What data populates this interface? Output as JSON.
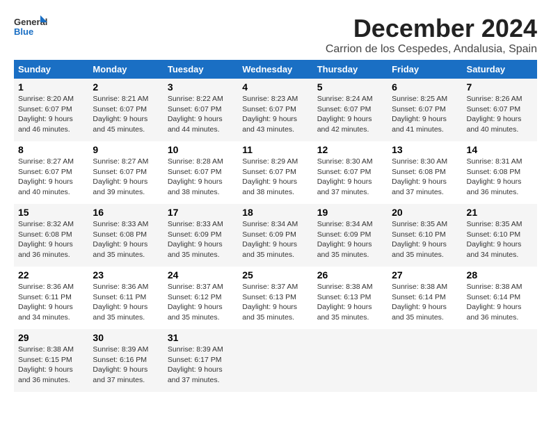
{
  "logo": {
    "line1": "General",
    "line2": "Blue"
  },
  "title": "December 2024",
  "subtitle": "Carrion de los Cespedes, Andalusia, Spain",
  "days_header": [
    "Sunday",
    "Monday",
    "Tuesday",
    "Wednesday",
    "Thursday",
    "Friday",
    "Saturday"
  ],
  "weeks": [
    [
      {
        "day": "1",
        "info": "Sunrise: 8:20 AM\nSunset: 6:07 PM\nDaylight: 9 hours\nand 46 minutes."
      },
      {
        "day": "2",
        "info": "Sunrise: 8:21 AM\nSunset: 6:07 PM\nDaylight: 9 hours\nand 45 minutes."
      },
      {
        "day": "3",
        "info": "Sunrise: 8:22 AM\nSunset: 6:07 PM\nDaylight: 9 hours\nand 44 minutes."
      },
      {
        "day": "4",
        "info": "Sunrise: 8:23 AM\nSunset: 6:07 PM\nDaylight: 9 hours\nand 43 minutes."
      },
      {
        "day": "5",
        "info": "Sunrise: 8:24 AM\nSunset: 6:07 PM\nDaylight: 9 hours\nand 42 minutes."
      },
      {
        "day": "6",
        "info": "Sunrise: 8:25 AM\nSunset: 6:07 PM\nDaylight: 9 hours\nand 41 minutes."
      },
      {
        "day": "7",
        "info": "Sunrise: 8:26 AM\nSunset: 6:07 PM\nDaylight: 9 hours\nand 40 minutes."
      }
    ],
    [
      {
        "day": "8",
        "info": "Sunrise: 8:27 AM\nSunset: 6:07 PM\nDaylight: 9 hours\nand 40 minutes."
      },
      {
        "day": "9",
        "info": "Sunrise: 8:27 AM\nSunset: 6:07 PM\nDaylight: 9 hours\nand 39 minutes."
      },
      {
        "day": "10",
        "info": "Sunrise: 8:28 AM\nSunset: 6:07 PM\nDaylight: 9 hours\nand 38 minutes."
      },
      {
        "day": "11",
        "info": "Sunrise: 8:29 AM\nSunset: 6:07 PM\nDaylight: 9 hours\nand 38 minutes."
      },
      {
        "day": "12",
        "info": "Sunrise: 8:30 AM\nSunset: 6:07 PM\nDaylight: 9 hours\nand 37 minutes."
      },
      {
        "day": "13",
        "info": "Sunrise: 8:30 AM\nSunset: 6:08 PM\nDaylight: 9 hours\nand 37 minutes."
      },
      {
        "day": "14",
        "info": "Sunrise: 8:31 AM\nSunset: 6:08 PM\nDaylight: 9 hours\nand 36 minutes."
      }
    ],
    [
      {
        "day": "15",
        "info": "Sunrise: 8:32 AM\nSunset: 6:08 PM\nDaylight: 9 hours\nand 36 minutes."
      },
      {
        "day": "16",
        "info": "Sunrise: 8:33 AM\nSunset: 6:08 PM\nDaylight: 9 hours\nand 35 minutes."
      },
      {
        "day": "17",
        "info": "Sunrise: 8:33 AM\nSunset: 6:09 PM\nDaylight: 9 hours\nand 35 minutes."
      },
      {
        "day": "18",
        "info": "Sunrise: 8:34 AM\nSunset: 6:09 PM\nDaylight: 9 hours\nand 35 minutes."
      },
      {
        "day": "19",
        "info": "Sunrise: 8:34 AM\nSunset: 6:09 PM\nDaylight: 9 hours\nand 35 minutes."
      },
      {
        "day": "20",
        "info": "Sunrise: 8:35 AM\nSunset: 6:10 PM\nDaylight: 9 hours\nand 35 minutes."
      },
      {
        "day": "21",
        "info": "Sunrise: 8:35 AM\nSunset: 6:10 PM\nDaylight: 9 hours\nand 34 minutes."
      }
    ],
    [
      {
        "day": "22",
        "info": "Sunrise: 8:36 AM\nSunset: 6:11 PM\nDaylight: 9 hours\nand 34 minutes."
      },
      {
        "day": "23",
        "info": "Sunrise: 8:36 AM\nSunset: 6:11 PM\nDaylight: 9 hours\nand 35 minutes."
      },
      {
        "day": "24",
        "info": "Sunrise: 8:37 AM\nSunset: 6:12 PM\nDaylight: 9 hours\nand 35 minutes."
      },
      {
        "day": "25",
        "info": "Sunrise: 8:37 AM\nSunset: 6:13 PM\nDaylight: 9 hours\nand 35 minutes."
      },
      {
        "day": "26",
        "info": "Sunrise: 8:38 AM\nSunset: 6:13 PM\nDaylight: 9 hours\nand 35 minutes."
      },
      {
        "day": "27",
        "info": "Sunrise: 8:38 AM\nSunset: 6:14 PM\nDaylight: 9 hours\nand 35 minutes."
      },
      {
        "day": "28",
        "info": "Sunrise: 8:38 AM\nSunset: 6:14 PM\nDaylight: 9 hours\nand 36 minutes."
      }
    ],
    [
      {
        "day": "29",
        "info": "Sunrise: 8:38 AM\nSunset: 6:15 PM\nDaylight: 9 hours\nand 36 minutes."
      },
      {
        "day": "30",
        "info": "Sunrise: 8:39 AM\nSunset: 6:16 PM\nDaylight: 9 hours\nand 37 minutes."
      },
      {
        "day": "31",
        "info": "Sunrise: 8:39 AM\nSunset: 6:17 PM\nDaylight: 9 hours\nand 37 minutes."
      },
      null,
      null,
      null,
      null
    ]
  ]
}
